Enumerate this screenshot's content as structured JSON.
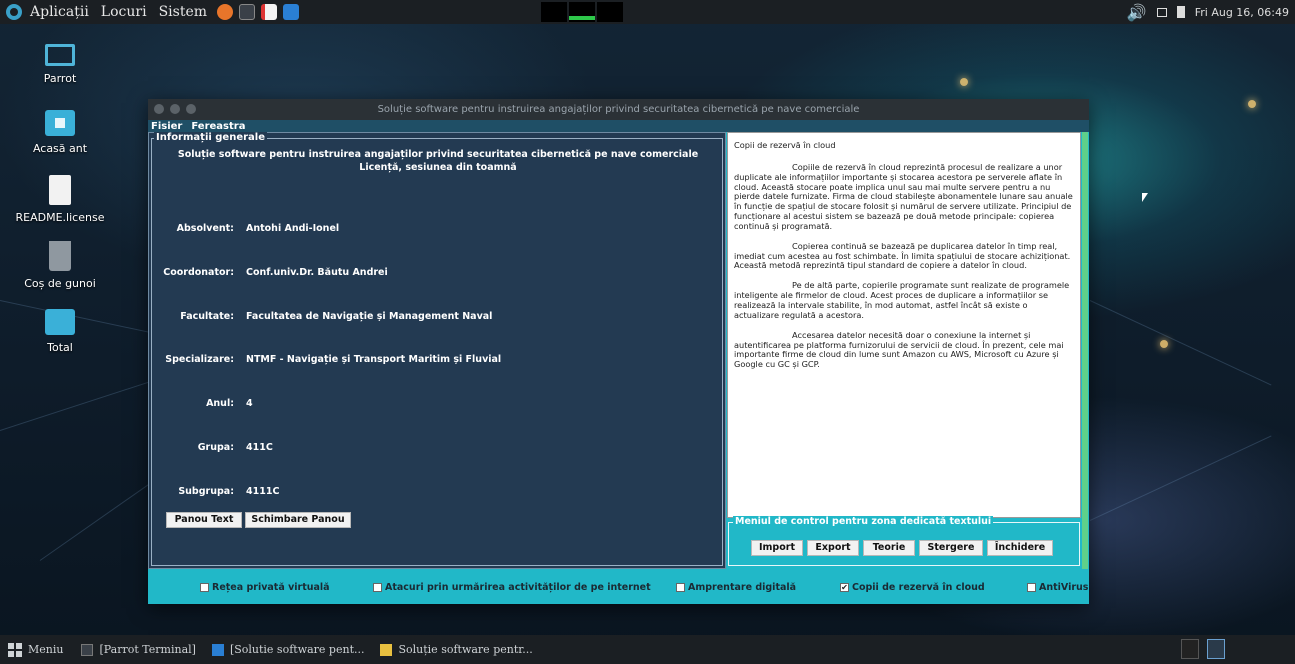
{
  "top_panel": {
    "menus": [
      "Aplicații",
      "Locuri",
      "Sistem"
    ],
    "datetime": "Fri Aug 16, 06:49",
    "icons": [
      "parrot-logo-icon",
      "firefox-icon",
      "terminal-icon",
      "text-editor-icon",
      "vscode-icon",
      "volume-icon",
      "screen-icon",
      "battery-icon"
    ]
  },
  "desktop": {
    "icons": [
      {
        "label": "Parrot",
        "icon": "computer-icon"
      },
      {
        "label": "Acasă ant",
        "icon": "home-folder-icon"
      },
      {
        "label": "README.license",
        "icon": "file-icon"
      },
      {
        "label": "Coș de gunoi",
        "icon": "trash-icon"
      },
      {
        "label": "Total",
        "icon": "folder-icon"
      }
    ]
  },
  "window": {
    "title": "Soluție software pentru instruirea angajaților privind securitatea cibernetică pe nave comerciale",
    "menu": [
      "Fisier",
      "Fereastra"
    ],
    "info_group": {
      "title": "Informații generale",
      "heading_line1": "Soluție software pentru instruirea angajaților privind securitatea cibernetică pe nave comerciale",
      "heading_line2": "Licență, sesiunea din toamnă",
      "rows": [
        {
          "label": "Absolvent:",
          "value": "Antohi Andi-Ionel"
        },
        {
          "label": "Coordonator:",
          "value": "Conf.univ.Dr. Băutu Andrei"
        },
        {
          "label": "Facultate:",
          "value": "Facultatea de Navigație și Management Naval"
        },
        {
          "label": "Specializare:",
          "value": "NTMF - Navigație și Transport Maritim și Fluvial"
        },
        {
          "label": "Anul:",
          "value": "4"
        },
        {
          "label": "Grupa:",
          "value": "411C"
        },
        {
          "label": "Subgrupa:",
          "value": "4111C"
        }
      ],
      "buttons": [
        "Panou Text",
        "Schimbare Panou"
      ]
    },
    "text_panel": {
      "title": "Copii de rezervă în cloud",
      "paragraphs": [
        "Copiile de rezervă în cloud reprezintă procesul de realizare a unor duplicate ale informațiilor importante și stocarea acestora pe serverele aflate în cloud. Această stocare poate implica unul sau mai multe servere pentru a nu pierde datele furnizate. Firma de cloud stabilește abonamentele lunare sau anuale în funcție de spațiul de stocare folosit și numărul de servere utilizate. Principiul de funcționare al acestui sistem se bazează pe două metode principale: copierea continuă și programată.",
        "Copierea continuă se bazează pe duplicarea datelor în timp real, imediat cum acestea au fost schimbate. În limita spațiului de stocare achiziționat. Această metodă reprezintă tipul standard de copiere a datelor în cloud.",
        "Pe de altă parte, copierile programate sunt realizate de programele inteligente ale firmelor de cloud. Acest proces de duplicare a informațiilor se realizează la intervale stabilite, în mod automat, astfel încât să existe o actualizare regulată a acestora.",
        "Accesarea datelor necesită doar o conexiune la internet și autentificarea pe platforma furnizorului de servicii de cloud. În prezent, cele mai importante firme de cloud din lume sunt Amazon cu AWS, Microsoft cu Azure și Google cu GC și GCP."
      ]
    },
    "control_group": {
      "title": "Meniul de control pentru zona dedicată textului",
      "buttons": [
        "Import",
        "Export",
        "Teorie",
        "Stergere",
        "Închidere"
      ]
    },
    "checkboxes": [
      {
        "label": "Rețea privată virtuală",
        "checked": false
      },
      {
        "label": "Atacuri prin urmărirea activităților de pe internet",
        "checked": false
      },
      {
        "label": "Amprentare digitală",
        "checked": false
      },
      {
        "label": "Copii de rezervă în cloud",
        "checked": true
      },
      {
        "label": "AntiVirus",
        "checked": false
      }
    ]
  },
  "taskbar": {
    "menu_label": "Meniu",
    "items": [
      "[Parrot Terminal]",
      "[Solutie software pent...",
      "Soluție software pentr..."
    ]
  },
  "colors": {
    "window_accent": "#21b8c8",
    "panel_dark": "#233a52",
    "menubar": "#1f4f66",
    "system_panel": "#1b1f23"
  }
}
